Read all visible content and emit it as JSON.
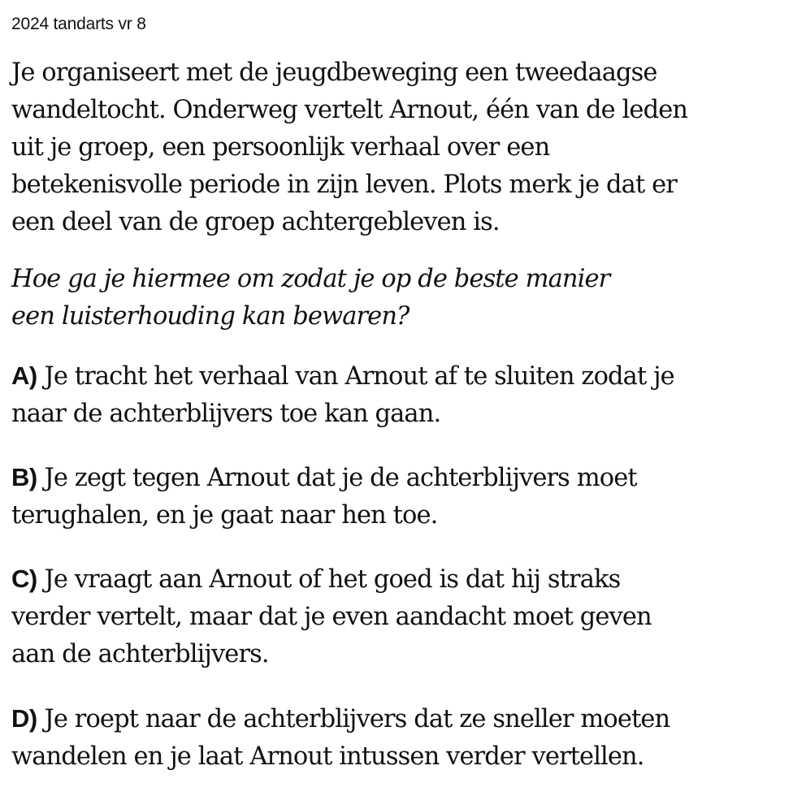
{
  "header": {
    "label": "2024 tandarts vr 8"
  },
  "intro": {
    "text": "Je organiseert met de jeugdbeweging een tweedaagse\nwandeltocht. Onderweg vertelt Arnout, één van de leden\nuit je groep, een persoonlijk verhaal over een\nbetekenisvolle periode in zijn leven. Plots merk je dat er\neen deel van de groep achtergebleven is."
  },
  "question": {
    "text": "Hoe ga je hiermee om zodat je op de beste manier\neen luisterhouding kan bewaren?"
  },
  "options": [
    {
      "letter": "A)",
      "text": " Je tracht het verhaal van Arnout af te sluiten zodat je\nnaar de achterblijvers toe kan gaan."
    },
    {
      "letter": "B)",
      "text": " Je zegt tegen Arnout dat je de achterblijvers moet\nterughalen, en je gaat naar hen toe."
    },
    {
      "letter": "C)",
      "text": " Je vraagt aan Arnout of het goed is dat hij straks\nverder vertelt, maar dat je even aandacht moet geven\naan de achterblijvers."
    },
    {
      "letter": "D)",
      "text": " Je roept naar de achterblijvers dat ze sneller moeten\nwandelen en je laat Arnout intussen verder vertellen."
    }
  ]
}
